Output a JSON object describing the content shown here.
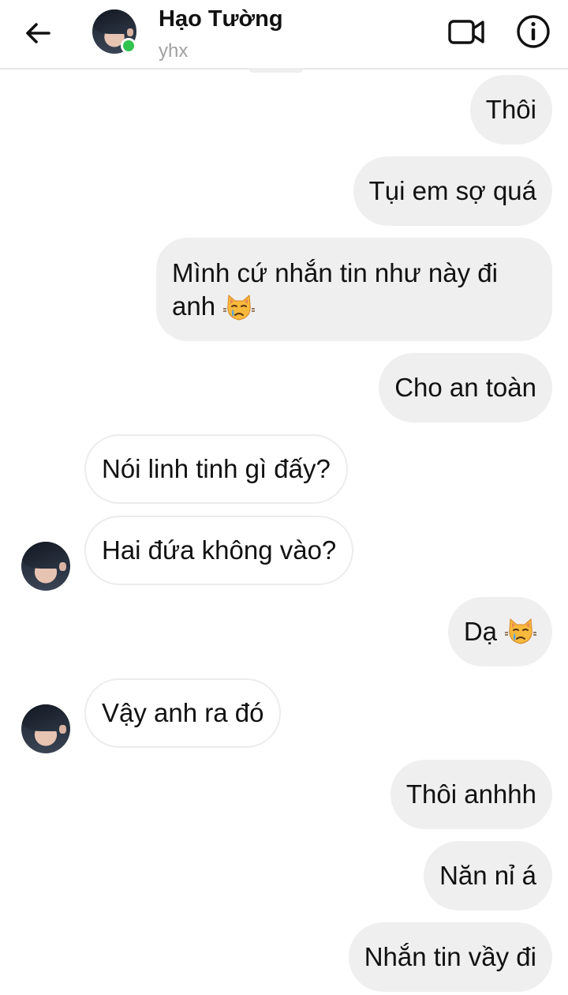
{
  "header": {
    "contact_name": "Hạo Tường",
    "username": "yhx",
    "back_icon": "arrow-left-icon",
    "video_icon": "video-camera-icon",
    "info_icon": "info-icon",
    "online_status_color": "#31c34e"
  },
  "messages": [
    {
      "text": "Thôi",
      "direction": "outgoing"
    },
    {
      "text": "Tụi em sợ quá",
      "direction": "outgoing"
    },
    {
      "text_line1": "Mình cứ nhắn tin như này đi",
      "text_line2": "anh",
      "emoji": "crying-cat-face",
      "direction": "outgoing"
    },
    {
      "text": "Cho an toàn",
      "direction": "outgoing"
    },
    {
      "text": "Nói linh tinh gì đấy?",
      "direction": "incoming"
    },
    {
      "text": "Hai đứa không vào?",
      "direction": "incoming"
    },
    {
      "text": "Dạ",
      "emoji": "crying-cat-face",
      "direction": "outgoing"
    },
    {
      "text": "Vậy anh ra đó",
      "direction": "incoming"
    },
    {
      "text": "Thôi anhhh",
      "direction": "outgoing"
    },
    {
      "text": "Năn nỉ á",
      "direction": "outgoing"
    },
    {
      "text": "Nhắn tin vầy đi",
      "direction": "outgoing"
    }
  ],
  "colors": {
    "outgoing_bubble": "#efefef",
    "incoming_bubble": "#ffffff",
    "incoming_border": "#ececec",
    "muted_text": "#a0a0a0"
  }
}
